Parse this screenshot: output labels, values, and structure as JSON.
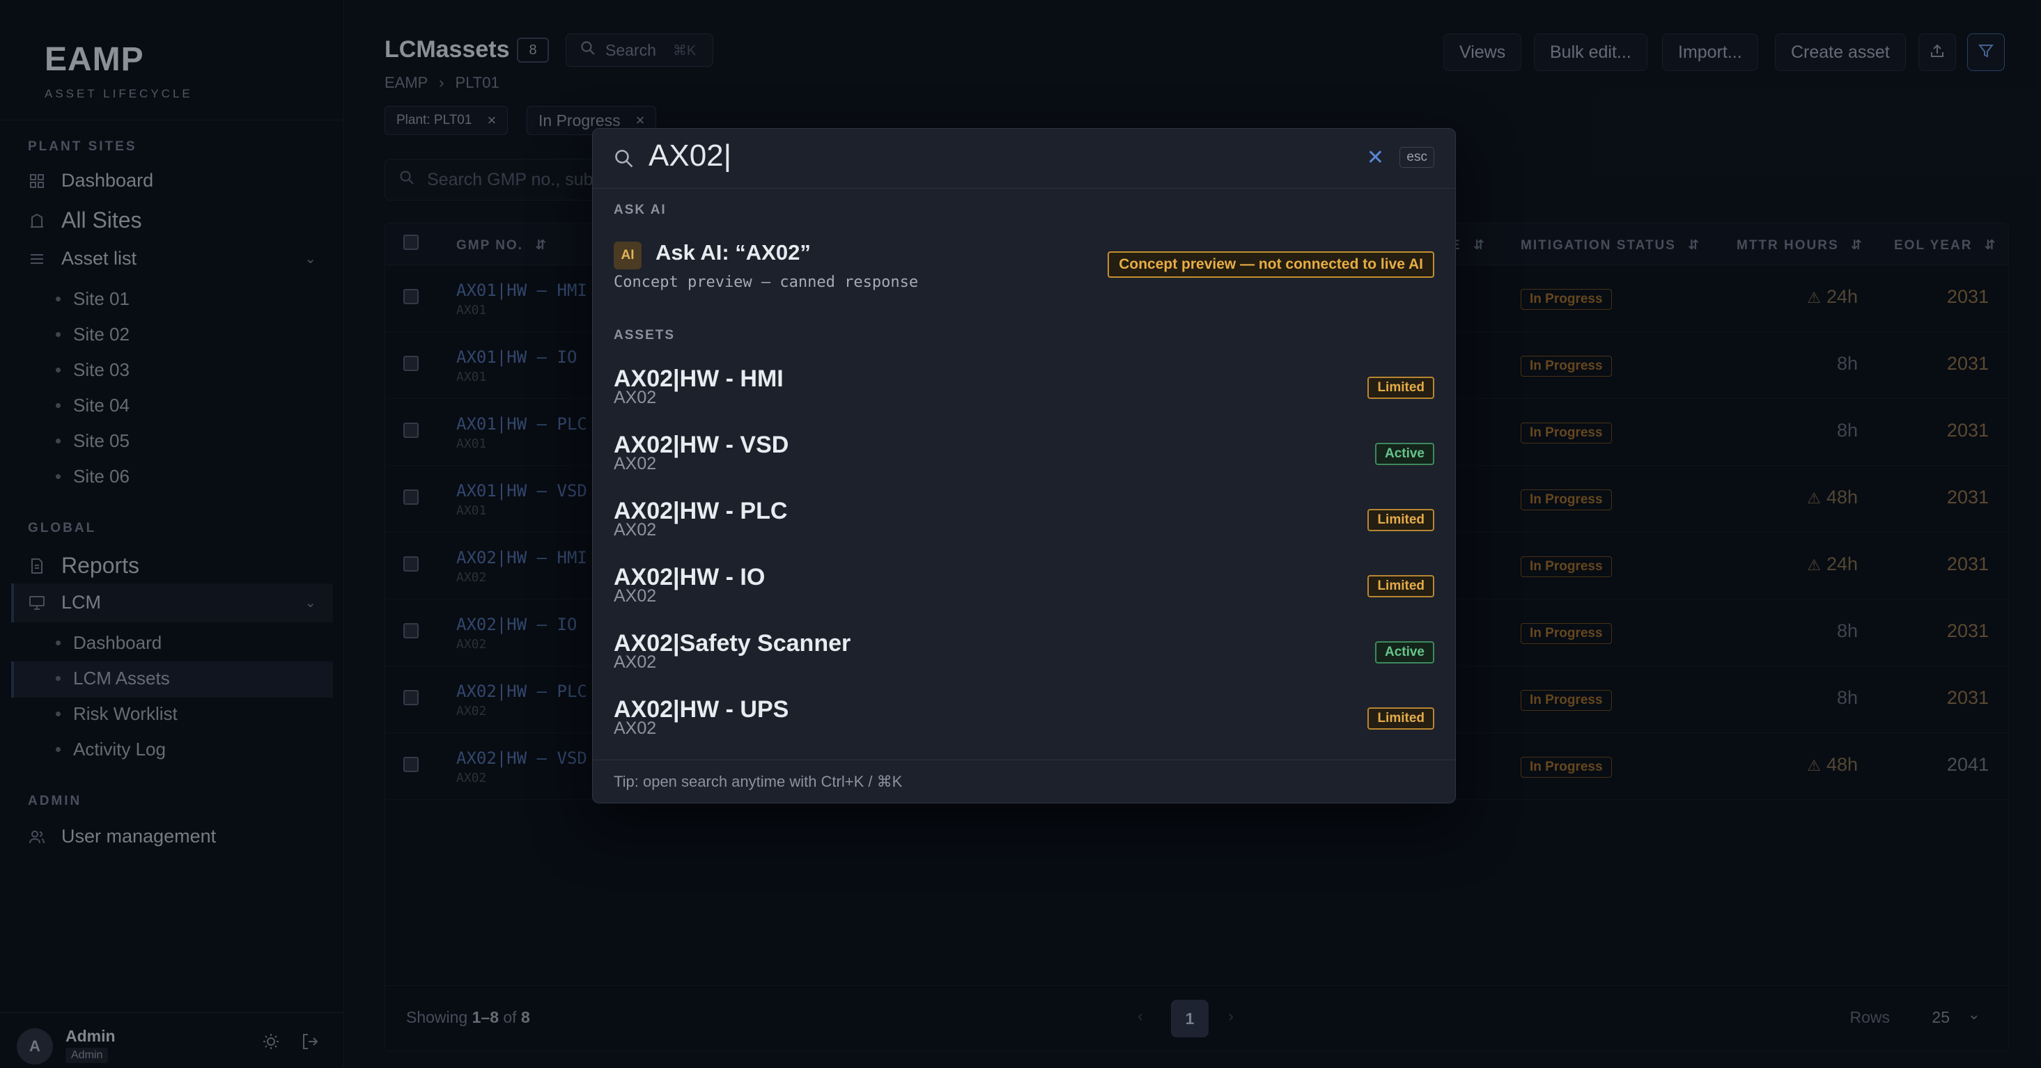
{
  "sidebar": {
    "brand_title": "EAMP",
    "brand_subtitle": "ASSET LIFECYCLE",
    "section_plant": "PLANT SITES",
    "dashboard": "Dashboard",
    "all_sites": "All Sites",
    "asset_list": "Asset list",
    "sites": [
      "Site 01",
      "Site 02",
      "Site 03",
      "Site 04",
      "Site 05",
      "Site 06"
    ],
    "section_global": "GLOBAL",
    "reports": "Reports",
    "lcm": "LCM",
    "lcm_items": [
      "Dashboard",
      "LCM Assets",
      "Risk Worklist",
      "Activity Log"
    ],
    "section_admin": "ADMIN",
    "user_management": "User management",
    "user": {
      "initial": "A",
      "name": "Admin",
      "role": "Admin"
    }
  },
  "header": {
    "title": "LCMassets",
    "count": "8",
    "search_label": "Search",
    "search_shortcut": "⌘K",
    "breadcrumb": [
      "EAMP",
      "PLT01"
    ],
    "buttons": {
      "views": "Views",
      "bulk_edit": "Bulk edit...",
      "import": "Import...",
      "create": "Create asset"
    }
  },
  "filters": [
    {
      "label": "Plant: PLT01"
    },
    {
      "label": "In Progress"
    }
  ],
  "table": {
    "search_placeholder": "Search GMP no., sub",
    "columns": {
      "gmp": "GMP NO.",
      "e": "E",
      "mitigation": "MITIGATION STATUS",
      "mttr": "MTTR HOURS",
      "eol": "EOL YEAR"
    },
    "rows": [
      {
        "gmp": "AX01|HW – HMI",
        "sub": "AX01",
        "mitigation": "In Progress",
        "mttr": "24h",
        "mttr_warn": true,
        "eol": "2031"
      },
      {
        "gmp": "AX01|HW – IO",
        "sub": "AX01",
        "mitigation": "In Progress",
        "mttr": "8h",
        "mttr_warn": false,
        "eol": "2031"
      },
      {
        "gmp": "AX01|HW – PLC",
        "sub": "AX01",
        "mitigation": "In Progress",
        "mttr": "8h",
        "mttr_warn": false,
        "eol": "2031"
      },
      {
        "gmp": "AX01|HW – VSD",
        "sub": "AX01",
        "mitigation": "In Progress",
        "mttr": "48h",
        "mttr_warn": true,
        "eol": "2031"
      },
      {
        "gmp": "AX02|HW – HMI",
        "sub": "AX02",
        "mitigation": "In Progress",
        "mttr": "24h",
        "mttr_warn": true,
        "eol": "2031"
      },
      {
        "gmp": "AX02|HW – IO",
        "sub": "AX02",
        "mitigation": "In Progress",
        "mttr": "8h",
        "mttr_warn": false,
        "eol": "2031"
      },
      {
        "gmp": "AX02|HW – PLC",
        "sub": "AX02",
        "mitigation": "In Progress",
        "mttr": "8h",
        "mttr_warn": false,
        "eol": "2031"
      },
      {
        "gmp": "AX02|HW – VSD",
        "sub": "AX02",
        "mitigation": "In Progress",
        "mttr": "48h",
        "mttr_warn": true,
        "eol": "2041"
      }
    ],
    "footer": {
      "showing_prefix": "Showing",
      "range": "1–8",
      "of": "of",
      "total": "8",
      "page": "1",
      "rows_label": "Rows",
      "rows_value": "25"
    }
  },
  "palette": {
    "query": "AX02|",
    "esc": "esc",
    "section_ai": "ASK AI",
    "ai_badge": "AI",
    "ai_title": "Ask AI: “AX02”",
    "ai_sub": "Concept preview — canned response",
    "concept_badge": "Concept preview — not connected to live AI",
    "section_assets": "ASSETS",
    "assets": [
      {
        "title": "AX02|HW - HMI",
        "sub": "AX02",
        "status": "Limited"
      },
      {
        "title": "AX02|HW - VSD",
        "sub": "AX02",
        "status": "Active"
      },
      {
        "title": "AX02|HW - PLC",
        "sub": "AX02",
        "status": "Limited"
      },
      {
        "title": "AX02|HW - IO",
        "sub": "AX02",
        "status": "Limited"
      },
      {
        "title": "AX02|Safety Scanner",
        "sub": "AX02",
        "status": "Active"
      },
      {
        "title": "AX02|HW - UPS",
        "sub": "AX02",
        "status": "Limited"
      }
    ],
    "tip": "Tip: open search anytime with Ctrl+K / ⌘K"
  }
}
